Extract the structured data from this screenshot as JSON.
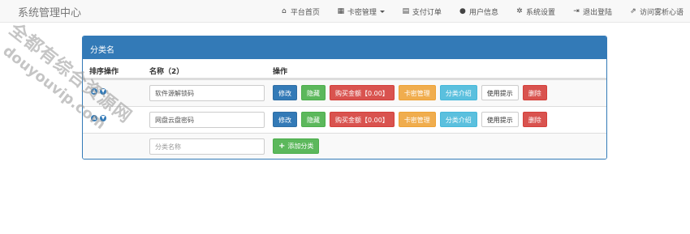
{
  "brand": "系统管理中心",
  "nav": [
    {
      "icon": "home-icon",
      "glyph": "⌂",
      "label": "平台首页"
    },
    {
      "icon": "grid-icon",
      "glyph": "▦",
      "label": "卡密管理",
      "dropdown": true
    },
    {
      "icon": "list-icon",
      "glyph": "▤",
      "label": "支付订单"
    },
    {
      "icon": "user-icon",
      "glyph": "●",
      "label": "用户信息"
    },
    {
      "icon": "gear-icon",
      "glyph": "✲",
      "label": "系统设置"
    },
    {
      "icon": "logout-icon",
      "glyph": "⇥",
      "label": "退出登陆"
    },
    {
      "icon": "external-link-icon",
      "glyph": "⇗",
      "label": "访问雾析心语"
    }
  ],
  "panel": {
    "title": "分类名",
    "headers": {
      "sort": "排序操作",
      "name": "名称（2）",
      "action": "操作"
    }
  },
  "rows": [
    {
      "name": "软件源解锁码",
      "buttons": [
        "修改",
        "隐藏",
        "购买金额【0.00】",
        "卡密管理",
        "分类介绍",
        "使用提示",
        "删除"
      ]
    },
    {
      "name": "网盘云盘密码",
      "buttons": [
        "修改",
        "隐藏",
        "购买金额【0.00】",
        "卡密管理",
        "分类介绍",
        "使用提示",
        "删除"
      ]
    }
  ],
  "new_row": {
    "placeholder": "分类名称",
    "add_label": "添加分类"
  },
  "watermark": {
    "line1": "全都有综合资源网",
    "line2": "douyouvip.com"
  }
}
